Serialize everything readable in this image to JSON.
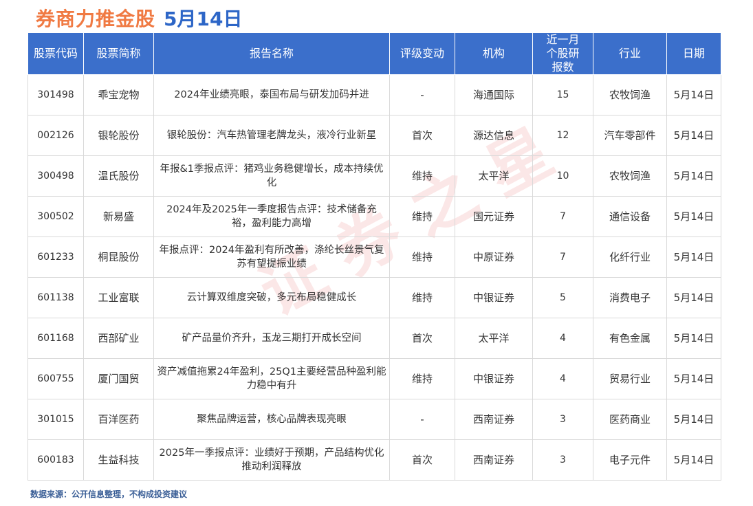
{
  "header": {
    "title": "券商力推金股",
    "date": "5月14日"
  },
  "table": {
    "columns": [
      "股票代码",
      "股票简称",
      "报告名称",
      "评级变动",
      "机构",
      "近一月个股研报数",
      "行业",
      "日期"
    ],
    "rows": [
      {
        "code": "301498",
        "name": "乖宝宠物",
        "report": "2024年业绩亮眼，泰国布局与研发加码并进",
        "rating": "-",
        "org": "海通国际",
        "count": "15",
        "industry": "农牧饲渔",
        "date": "5月14日"
      },
      {
        "code": "002126",
        "name": "银轮股份",
        "report": "银轮股份：汽车热管理老牌龙头，液冷行业新星",
        "rating": "首次",
        "org": "源达信息",
        "count": "12",
        "industry": "汽车零部件",
        "date": "5月14日"
      },
      {
        "code": "300498",
        "name": "温氏股份",
        "report": "年报&1季报点评：猪鸡业务稳健增长，成本持续优化",
        "rating": "维持",
        "org": "太平洋",
        "count": "10",
        "industry": "农牧饲渔",
        "date": "5月14日"
      },
      {
        "code": "300502",
        "name": "新易盛",
        "report": "2024年及2025年一季度报告点评：技术储备充裕，盈利能力高增",
        "rating": "维持",
        "org": "国元证券",
        "count": "7",
        "industry": "通信设备",
        "date": "5月14日"
      },
      {
        "code": "601233",
        "name": "桐昆股份",
        "report": "年报点评：2024年盈利有所改善，涤纶长丝景气复苏有望提振业绩",
        "rating": "维持",
        "org": "中原证券",
        "count": "7",
        "industry": "化纤行业",
        "date": "5月14日"
      },
      {
        "code": "601138",
        "name": "工业富联",
        "report": "云计算双维度突破，多元布局稳健成长",
        "rating": "维持",
        "org": "中银证券",
        "count": "5",
        "industry": "消费电子",
        "date": "5月14日"
      },
      {
        "code": "601168",
        "name": "西部矿业",
        "report": "矿产品量价齐升，玉龙三期打开成长空间",
        "rating": "首次",
        "org": "太平洋",
        "count": "4",
        "industry": "有色金属",
        "date": "5月14日"
      },
      {
        "code": "600755",
        "name": "厦门国贸",
        "report": "资产减值拖累24年盈利，25Q1主要经营品种盈利能力稳中有升",
        "rating": "维持",
        "org": "中银证券",
        "count": "4",
        "industry": "贸易行业",
        "date": "5月14日"
      },
      {
        "code": "301015",
        "name": "百洋医药",
        "report": "聚焦品牌运营，核心品牌表现亮眼",
        "rating": "-",
        "org": "西南证券",
        "count": "3",
        "industry": "医药商业",
        "date": "5月14日"
      },
      {
        "code": "600183",
        "name": "生益科技",
        "report": "2025年一季报点评：业绩好于预期，产品结构优化推动利润释放",
        "rating": "首次",
        "org": "西南证券",
        "count": "3",
        "industry": "电子元件",
        "date": "5月14日"
      }
    ]
  },
  "footer": {
    "source": "数据来源：公开信息整理，不构成投资建议"
  },
  "colors": {
    "title": "#f07a43",
    "date": "#2d66c7",
    "header_bg": "#3b6fcb"
  }
}
